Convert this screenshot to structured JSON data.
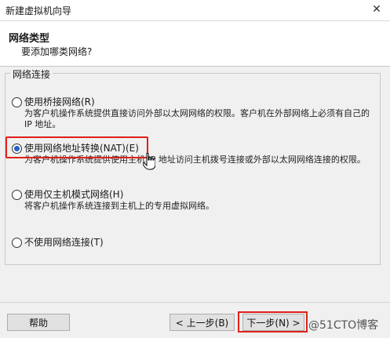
{
  "window": {
    "title": "新建虚拟机向导",
    "close_glyph": "✕"
  },
  "header": {
    "title": "网络类型",
    "subtitle": "要添加哪类网络?"
  },
  "group": {
    "label": "网络连接",
    "options": [
      {
        "label": "使用桥接网络(R)",
        "description": "为客户机操作系统提供直接访问外部以太网网络的权限。客户机在外部网络上必须有自己的 IP 地址。",
        "checked": false
      },
      {
        "label": "使用网络地址转换(NAT)(E)",
        "description": "为客户机操作系统提供使用主机 IP 地址访问主机拨号连接或外部以太网网络连接的权限。",
        "checked": true
      },
      {
        "label": "使用仅主机模式网络(H)",
        "description": "将客户机操作系统连接到主机上的专用虚拟网络。",
        "checked": false
      },
      {
        "label": "不使用网络连接(T)",
        "description": "",
        "checked": false
      }
    ]
  },
  "buttons": {
    "help": "帮助",
    "back": "< 上一步(B)",
    "next": "下一步(N) >"
  },
  "watermark": "@51CTO博客",
  "colors": {
    "highlight": "#e0201a",
    "radio_fill": "#2060c8"
  }
}
